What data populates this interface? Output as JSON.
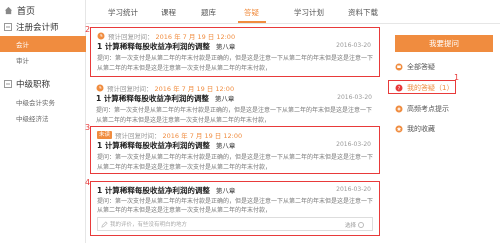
{
  "sidebar": {
    "home": "首页",
    "categories": [
      {
        "label": "注册会计师",
        "subs": [
          "会计",
          "审计"
        ]
      },
      {
        "label": "中级职称",
        "subs": [
          "中级会计实务",
          "中级经济法"
        ]
      }
    ]
  },
  "tabs": [
    "学习统计",
    "课程",
    "题库",
    "答疑",
    "学习计划",
    "资料下载"
  ],
  "active_tab": "答疑",
  "cards": [
    {
      "meta_label": "预计回复时间：",
      "meta_date": "2016 年 7 月 19 日 12:00",
      "title": "1 计算稀释每股收益净利润的调整",
      "chapter": "第八章",
      "date": "2016-03-20",
      "q1": "提问：第一次支付是从第二年的年末付款是正确的，但是这是注意一下从第二年的年末但是这是注意一下",
      "q2": "从第二年的年末但是这是注意第一次支付是从第二年的年末付款，"
    },
    {
      "meta_label": "预计回复时间：",
      "meta_date": "2016 年 7 月 19 日 12:00",
      "title": "1 计算稀释每股收益净利润的调整",
      "chapter": "第八章",
      "date": "2016-03-20",
      "q1": "提问：第一次支付是从第二年的年末付款是正确的，但是这是注意一下从第二年的年末但是这是注意一下",
      "q2": "从第二年的年末但是这是注意第一次支付是从第二年的年末付款，"
    },
    {
      "tag": "未读",
      "meta_label": "预计回复时间：",
      "meta_date": "2016 年 7 月 19 日 12:00",
      "title": "1 计算稀释每股收益净利润的调整",
      "chapter": "第八章",
      "date": "2016-03-20",
      "q1": "提问：第一次支付是从第二年的年末付款是正确的，但是这是注意一下从第二年的年末但是这是注意一下",
      "q2": "从第二年的年末但是这是注意第一次支付是从第二年的年末付款，"
    },
    {
      "title": "1 计算稀释每股收益净利润的调整",
      "chapter": "第八章",
      "date": "2016-03-20",
      "q1": "提问：第一次支付是从第二年的年末付款是正确的，但是这是注意一下从第二年的年末但是这是注意一下",
      "q2": "从第二年的年末但是这是注意第一次支付是从第二年的年末付款，",
      "input_placeholder": "我的评价，有些没有明白的地方",
      "select_label": "选择"
    }
  ],
  "annotations": [
    "1",
    "2",
    "3",
    "4"
  ],
  "right_panel": {
    "ask_button": "我要提问",
    "items": [
      "全部答疑",
      "我的答疑（1）",
      "高频考点提示",
      "我的收藏"
    ],
    "active_index": 1
  },
  "colors": {
    "accent": "#f08c3f",
    "annotation": "#e83a3a"
  }
}
